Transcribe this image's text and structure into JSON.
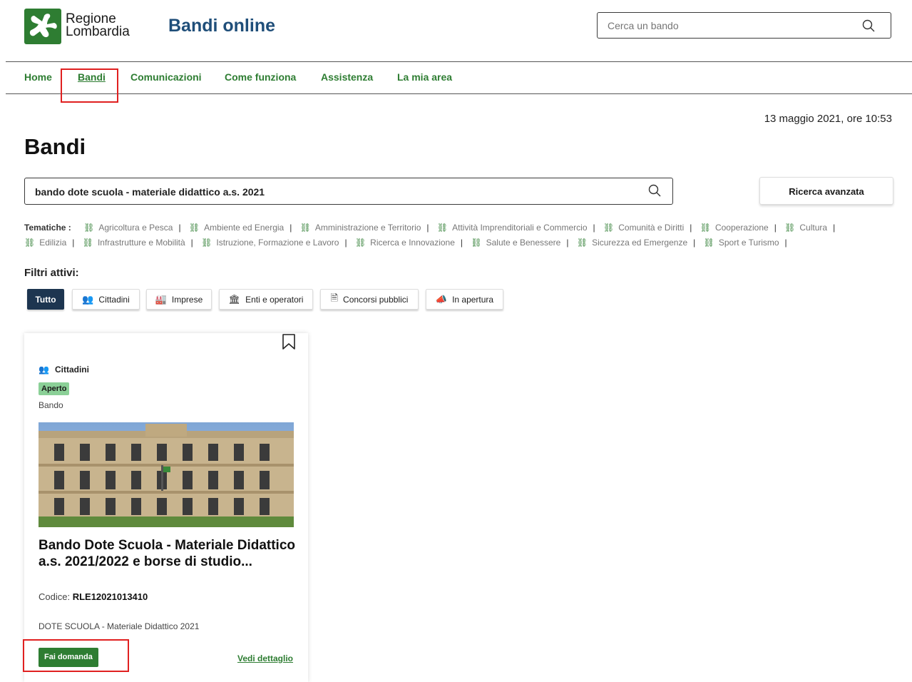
{
  "header": {
    "logo_line1": "Regione",
    "logo_line2": "Lombardia",
    "app_title": "Bandi online",
    "search_placeholder": "Cerca un bando"
  },
  "nav": {
    "items": [
      {
        "label": "Home"
      },
      {
        "label": "Bandi"
      },
      {
        "label": "Comunicazioni"
      },
      {
        "label": "Come funziona"
      },
      {
        "label": "Assistenza"
      },
      {
        "label": "La mia area"
      }
    ],
    "active": "Bandi"
  },
  "date": "13 maggio 2021, ore 10:53",
  "page_title": "Bandi",
  "search": {
    "value": "bando dote scuola - materiale didattico a.s. 2021",
    "advanced_label": "Ricerca avanzata"
  },
  "tematiche": {
    "label": "Tematiche :",
    "items": [
      "Agricoltura e Pesca",
      "Ambiente ed Energia",
      "Amministrazione e Territorio",
      "Attività Imprenditoriali e Commercio",
      "Comunità e Diritti",
      "Cooperazione",
      "Cultura",
      "Edilizia",
      "Infrastrutture e Mobilità",
      "Istruzione, Formazione e Lavoro",
      "Ricerca e Innovazione",
      "Salute e Benessere",
      "Sicurezza ed Emergenze",
      "Sport e Turismo"
    ]
  },
  "filters": {
    "label": "Filtri attivi:",
    "chips": [
      {
        "label": "Tutto",
        "icon": "none"
      },
      {
        "label": "Cittadini",
        "icon": "people-icon"
      },
      {
        "label": "Imprese",
        "icon": "factory-icon"
      },
      {
        "label": "Enti e operatori",
        "icon": "building-icon"
      },
      {
        "label": "Concorsi pubblici",
        "icon": "document-icon"
      },
      {
        "label": "In apertura",
        "icon": "megaphone-icon"
      }
    ],
    "active": "Tutto"
  },
  "card": {
    "category": "Cittadini",
    "status": "Aperto",
    "type": "Bando",
    "title": "Bando Dote Scuola - Materiale Didattico a.s. 2021/2022 e borse di studio...",
    "codice_label": "Codice:",
    "codice_value": "RLE12021013410",
    "description": "DOTE SCUOLA - Materiale Didattico 2021",
    "apply_label": "Fai domanda",
    "detail_label": "Vedi dettaglio"
  },
  "colors": {
    "brand_green": "#2e7d32",
    "title_blue": "#1f4e79",
    "active_chip": "#1d3550",
    "badge_green": "#8bd097",
    "highlight_red": "#e02020"
  }
}
